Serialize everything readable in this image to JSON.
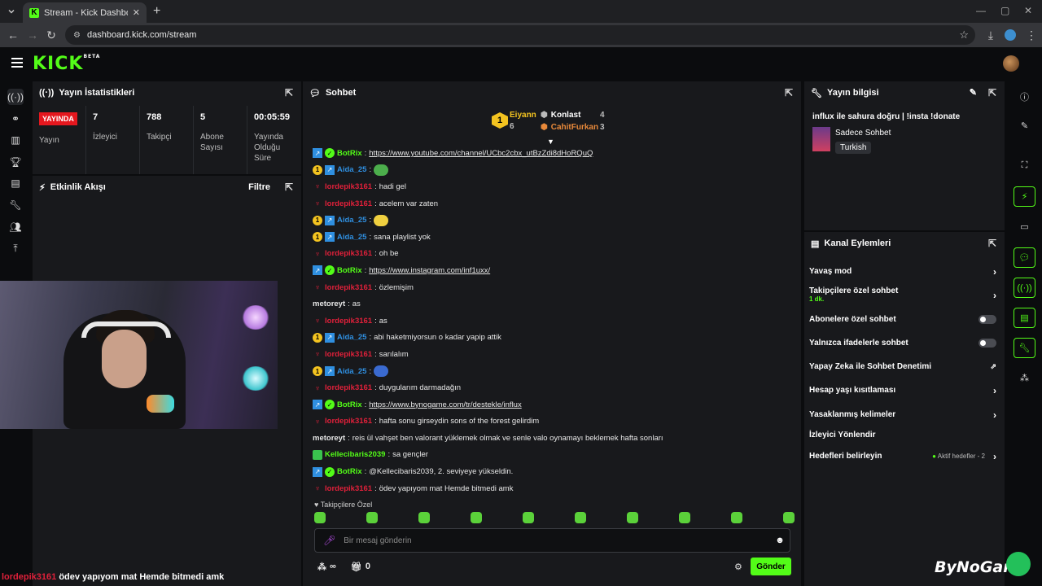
{
  "browser": {
    "tab_title": "Stream - Kick Dashboard",
    "url": "dashboard.kick.com/stream"
  },
  "header": {
    "logo": "KICK",
    "logo_sup": "BETA"
  },
  "stats_panel": {
    "title": "Yayın İstatistikleri",
    "live_badge": "YAYINDA",
    "live_label": "Yayın",
    "items": [
      {
        "value": "7",
        "label": "İzleyici"
      },
      {
        "value": "788",
        "label": "Takipçi"
      },
      {
        "value": "5",
        "label": "Abone Sayısı"
      },
      {
        "value": "00:05:59",
        "label": "Yayında Olduğu Süre"
      }
    ]
  },
  "activity_panel": {
    "title": "Etkinlik Akışı",
    "filter": "Filtre"
  },
  "chat": {
    "title": "Sohbet",
    "leaders": {
      "first_name": "Eiyann",
      "first_count": "6",
      "second_name": "Konlast",
      "second_count": "4",
      "third_name": "CahitFurkan",
      "third_count": "3"
    },
    "messages": [
      {
        "badges": [
          "blue",
          "green"
        ],
        "user": "BotRix",
        "color": "#53fc18",
        "text": "",
        "link": "https://www.youtube.com/channel/UCbc2cbx_utBzZdi8dHoRQuQ"
      },
      {
        "badges": [
          "rank",
          "blue"
        ],
        "user": "Aida_25",
        "color": "#2f8fe0",
        "text": "",
        "emote": "g"
      },
      {
        "badges": [
          "red"
        ],
        "user": "lordepik3161",
        "color": "#e0203a",
        "text": "hadi gel"
      },
      {
        "badges": [
          "red"
        ],
        "user": "lordepik3161",
        "color": "#e0203a",
        "text": "acelem var zaten"
      },
      {
        "badges": [
          "rank",
          "blue"
        ],
        "user": "Aida_25",
        "color": "#2f8fe0",
        "text": "",
        "emote": "y"
      },
      {
        "badges": [
          "rank",
          "blue"
        ],
        "user": "Aida_25",
        "color": "#2f8fe0",
        "text": "sana playlist yok"
      },
      {
        "badges": [
          "red"
        ],
        "user": "lordepik3161",
        "color": "#e0203a",
        "text": "oh be"
      },
      {
        "badges": [
          "blue",
          "green"
        ],
        "user": "BotRix",
        "color": "#53fc18",
        "text": "",
        "link": "https://www.instagram.com/inf1uxx/"
      },
      {
        "badges": [
          "red"
        ],
        "user": "lordepik3161",
        "color": "#e0203a",
        "text": "özlemişim"
      },
      {
        "badges": [],
        "user": "metoreyt",
        "color": "#e8e8e8",
        "text": "as"
      },
      {
        "badges": [
          "red"
        ],
        "user": "lordepik3161",
        "color": "#e0203a",
        "text": "as"
      },
      {
        "badges": [
          "rank",
          "blue"
        ],
        "user": "Aida_25",
        "color": "#2f8fe0",
        "text": "abi haketmiyorsun o kadar yapip attik"
      },
      {
        "badges": [
          "red"
        ],
        "user": "lordepik3161",
        "color": "#e0203a",
        "text": "sarılalım"
      },
      {
        "badges": [
          "rank",
          "blue"
        ],
        "user": "Aida_25",
        "color": "#2f8fe0",
        "text": "",
        "emote": "b"
      },
      {
        "badges": [
          "red"
        ],
        "user": "lordepik3161",
        "color": "#e0203a",
        "text": "duygularım darmadağın"
      },
      {
        "badges": [
          "blue",
          "green"
        ],
        "user": "BotRix",
        "color": "#53fc18",
        "text": "",
        "link": "https://www.bynogame.com/tr/destekle/influx"
      },
      {
        "badges": [
          "red"
        ],
        "user": "lordepik3161",
        "color": "#e0203a",
        "text": "hafta sonu girseydin sons of the forest gelirdim"
      },
      {
        "badges": [],
        "user": "metoreyt",
        "color": "#e8e8e8",
        "text": "reis ül vahşet ben valorant yüklemek olmak ve senle valo oynamayı beklemek hafta sonları"
      },
      {
        "badges": [
          "sub"
        ],
        "user": "Kellecibaris2039",
        "color": "#53fc18",
        "text": "sa gençler"
      },
      {
        "badges": [
          "blue",
          "green"
        ],
        "user": "BotRix",
        "color": "#53fc18",
        "text": "@Kellecibaris2039, 2. seviyeye yükseldin."
      },
      {
        "badges": [
          "red"
        ],
        "user": "lordepik3161",
        "color": "#e0203a",
        "text": "ödev yapıyom mat Hemde bitmedi amk"
      }
    ],
    "followers_only": "Takipçilere Özel",
    "input_placeholder": "Bir mesaj gönderin",
    "infinity": "∞",
    "points": "0",
    "send_label": "Gönder"
  },
  "stream_info": {
    "title": "Yayın bilgisi",
    "stream_title": "influx ile sahura doğru | !insta !donate",
    "category": "Sadece Sohbet",
    "language": "Turkish"
  },
  "channel_actions": {
    "title": "Kanal Eylemleri",
    "slow_mode": "Yavaş mod",
    "followers_chat": "Takipçilere özel sohbet",
    "followers_chat_sub": "1 dk.",
    "subs_chat": "Abonelere özel sohbet",
    "emote_chat": "Yalnızca ifadelerle sohbet",
    "ai_moderation": "Yapay Zeka ile Sohbet Denetimi",
    "account_age": "Hesap yaşı kısıtlaması",
    "banned_words": "Yasaklanmış kelimeler",
    "host": "İzleyici Yönlendir",
    "goals": "Hedefleri belirleyin",
    "goals_status": "Aktif hedefler - 2"
  },
  "overlay": {
    "user": "lordepik3161",
    "text": "ödev yapıyom mat Hemde bitmedi amk",
    "brand": "ByNoGame"
  }
}
